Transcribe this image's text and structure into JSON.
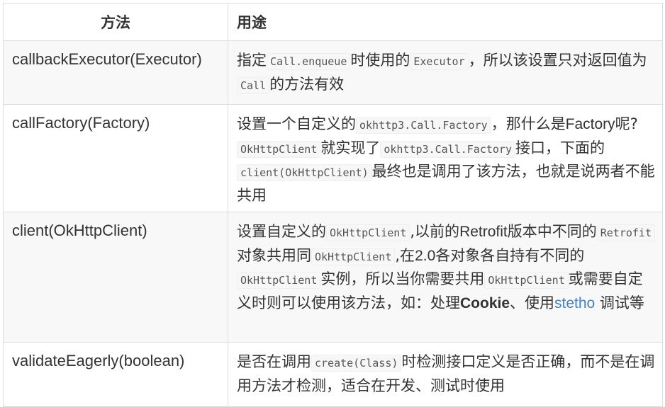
{
  "header": {
    "method": "方法",
    "usage": "用途"
  },
  "rows": [
    {
      "method": "callbackExecutor(Executor)",
      "t1": "指定",
      "c1": "Call.enqueue",
      "t2": "时使用的",
      "c2": "Executor",
      "t3": "，所以该设置只对返回值为",
      "c3": "Call",
      "t4": "的方法有效"
    },
    {
      "method": "callFactory(Factory)",
      "t1": "设置一个自定义的",
      "c1": "okhttp3.Call.Factory",
      "t2": "，那什么是",
      "t3": "Factory",
      "t4": "呢?",
      "c2": "OkHttpClient",
      "t5": "就实现了",
      "c3": "okhttp3.Call.Factory",
      "t6": "接口，下面的",
      "c4": "client(OkHttpClient)",
      "t7": "最终也是调用了该方法，也就是说两者不能共用"
    },
    {
      "method": "client(OkHttpClient)",
      "t1": "设置自定义的",
      "c1": "OkHttpClient",
      "t2": ",以前的",
      "t3": "Retrofit",
      "t4": "版本中不同的",
      "c2": "Retrofit",
      "t5": "对象共用同",
      "c3": "OkHttpClient",
      "t6": ",在",
      "t7": "2.0",
      "t8": "各对象各自持有不同的",
      "c4": "OkHttpClient",
      "t9": "实例，所以当你需要共用",
      "c5": "OkHttpClient",
      "t10": "或需要自定义时则可以使用该方法，如：处理",
      "b1": "Cookie",
      "t11": "、使用",
      "link": "stetho",
      "t12": " 调试等"
    },
    {
      "method": "validateEagerly(boolean)",
      "t1": "是否在调用",
      "c1": "create(Class)",
      "t2": "时检测接口定义是否正确，而不是在调用方法才检测，适合在开发、测试时使用"
    }
  ]
}
